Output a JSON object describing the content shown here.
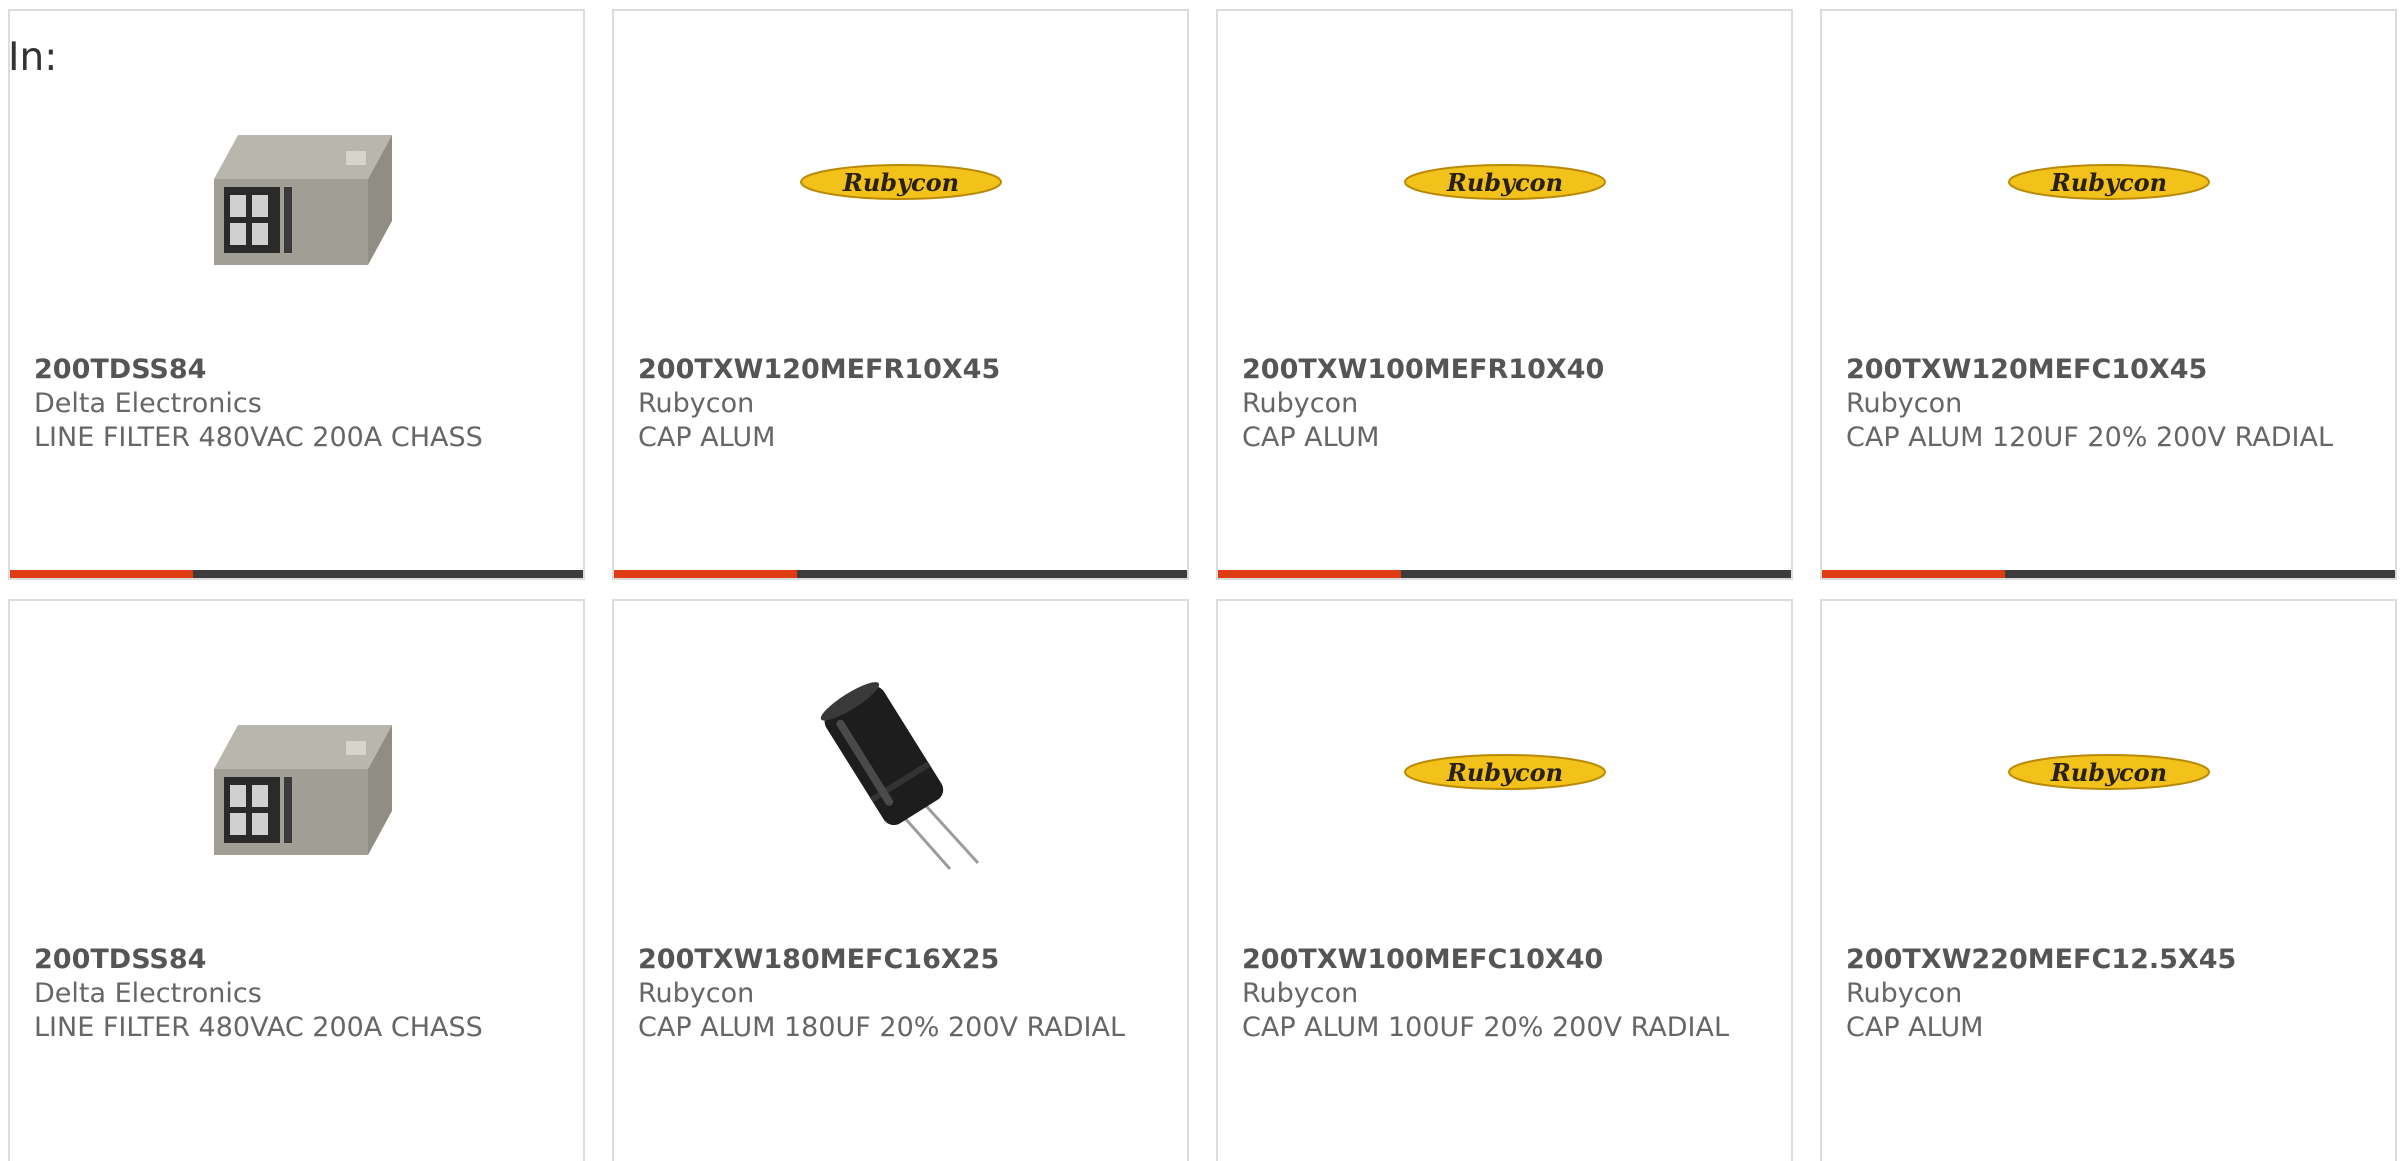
{
  "header": {
    "in_label": "In:"
  },
  "colors": {
    "accent": "#e03c14",
    "bar_track": "#3d3d3d",
    "text": "#666666",
    "border": "#dcdcdc"
  },
  "products": [
    {
      "part_number": "200TDSS84",
      "manufacturer": "Delta Electronics",
      "description": "LINE FILTER 480VAC 200A CHASS",
      "image": "line-filter-image",
      "progress": 0.32
    },
    {
      "part_number": "200TXW120MEFR10X45",
      "manufacturer": "Rubycon",
      "description": "CAP ALUM",
      "image": "rubycon-logo",
      "logo_text": "Rubycon",
      "progress": 0.32
    },
    {
      "part_number": "200TXW100MEFR10X40",
      "manufacturer": "Rubycon",
      "description": "CAP ALUM",
      "image": "rubycon-logo",
      "logo_text": "Rubycon",
      "progress": 0.32
    },
    {
      "part_number": "200TXW120MEFC10X45",
      "manufacturer": "Rubycon",
      "description": "CAP ALUM 120UF 20% 200V RADIAL",
      "image": "rubycon-logo",
      "logo_text": "Rubycon",
      "progress": 0.32
    },
    {
      "part_number": "200TDSS84",
      "manufacturer": "Delta Electronics",
      "description": "LINE FILTER 480VAC 200A CHASS",
      "image": "line-filter-image"
    },
    {
      "part_number": "200TXW180MEFC16X25",
      "manufacturer": "Rubycon",
      "description": "CAP ALUM 180UF 20% 200V RADIAL",
      "image": "capacitor-image"
    },
    {
      "part_number": "200TXW100MEFC10X40",
      "manufacturer": "Rubycon",
      "description": "CAP ALUM 100UF 20% 200V RADIAL",
      "image": "rubycon-logo",
      "logo_text": "Rubycon"
    },
    {
      "part_number": "200TXW220MEFC12.5X45",
      "manufacturer": "Rubycon",
      "description": "CAP ALUM",
      "image": "rubycon-logo",
      "logo_text": "Rubycon"
    }
  ]
}
